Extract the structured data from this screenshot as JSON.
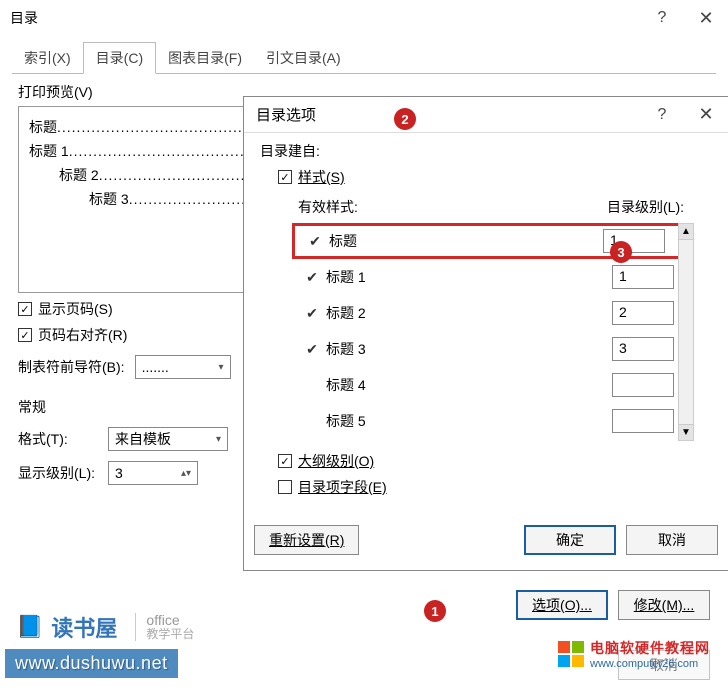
{
  "dialog1": {
    "title": "目录",
    "help": "?",
    "close": "✕",
    "tabs": {
      "index": "索引(X)",
      "toc": "目录(C)",
      "figtoc": "图表目录(F)",
      "citetoc": "引文目录(A)"
    },
    "print_preview_label": "打印预览(V)",
    "preview": [
      {
        "label": "标题",
        "indent": 0
      },
      {
        "label": "标题 1",
        "indent": 0
      },
      {
        "label": "标题 2",
        "indent": 30
      },
      {
        "label": "标题 3",
        "indent": 60
      }
    ],
    "show_page_numbers": "显示页码(S)",
    "right_align": "页码右对齐(R)",
    "leader_label": "制表符前导符(B):",
    "leader_value": ".......",
    "general_label": "常规",
    "format_label": "格式(T):",
    "format_value": "来自模板",
    "show_levels_label": "显示级别(L):",
    "show_levels_value": "3",
    "options_btn": "选项(O)...",
    "modify_btn": "修改(M)...",
    "cancel_btn": "取消"
  },
  "dialog2": {
    "title": "目录选项",
    "help": "?",
    "close": "✕",
    "build_from": "目录建自:",
    "styles_ck": "样式(S)",
    "valid_styles": "有效样式:",
    "toc_level": "目录级别(L):",
    "rows": [
      {
        "checked": "✔",
        "name": "标题",
        "level": "1"
      },
      {
        "checked": "✔",
        "name": "标题 1",
        "level": "1"
      },
      {
        "checked": "✔",
        "name": "标题 2",
        "level": "2"
      },
      {
        "checked": "✔",
        "name": "标题 3",
        "level": "3"
      },
      {
        "checked": "",
        "name": "标题 4",
        "level": ""
      },
      {
        "checked": "",
        "name": "标题 5",
        "level": ""
      }
    ],
    "outline_ck": "大纲级别(O)",
    "entry_ck": "目录项字段(E)",
    "reset_btn": "重新设置(R)",
    "ok_btn": "确定",
    "cancel_btn": "取消"
  },
  "annotations": {
    "b1": "1",
    "b2": "2",
    "b3": "3"
  },
  "watermark": {
    "brand": "读书屋",
    "office": "office",
    "office_sub": "教学平台",
    "url": "www.dushuwu.net",
    "site2_name": "电脑软硬件教程网",
    "site2_url": "www.computer26.com"
  }
}
